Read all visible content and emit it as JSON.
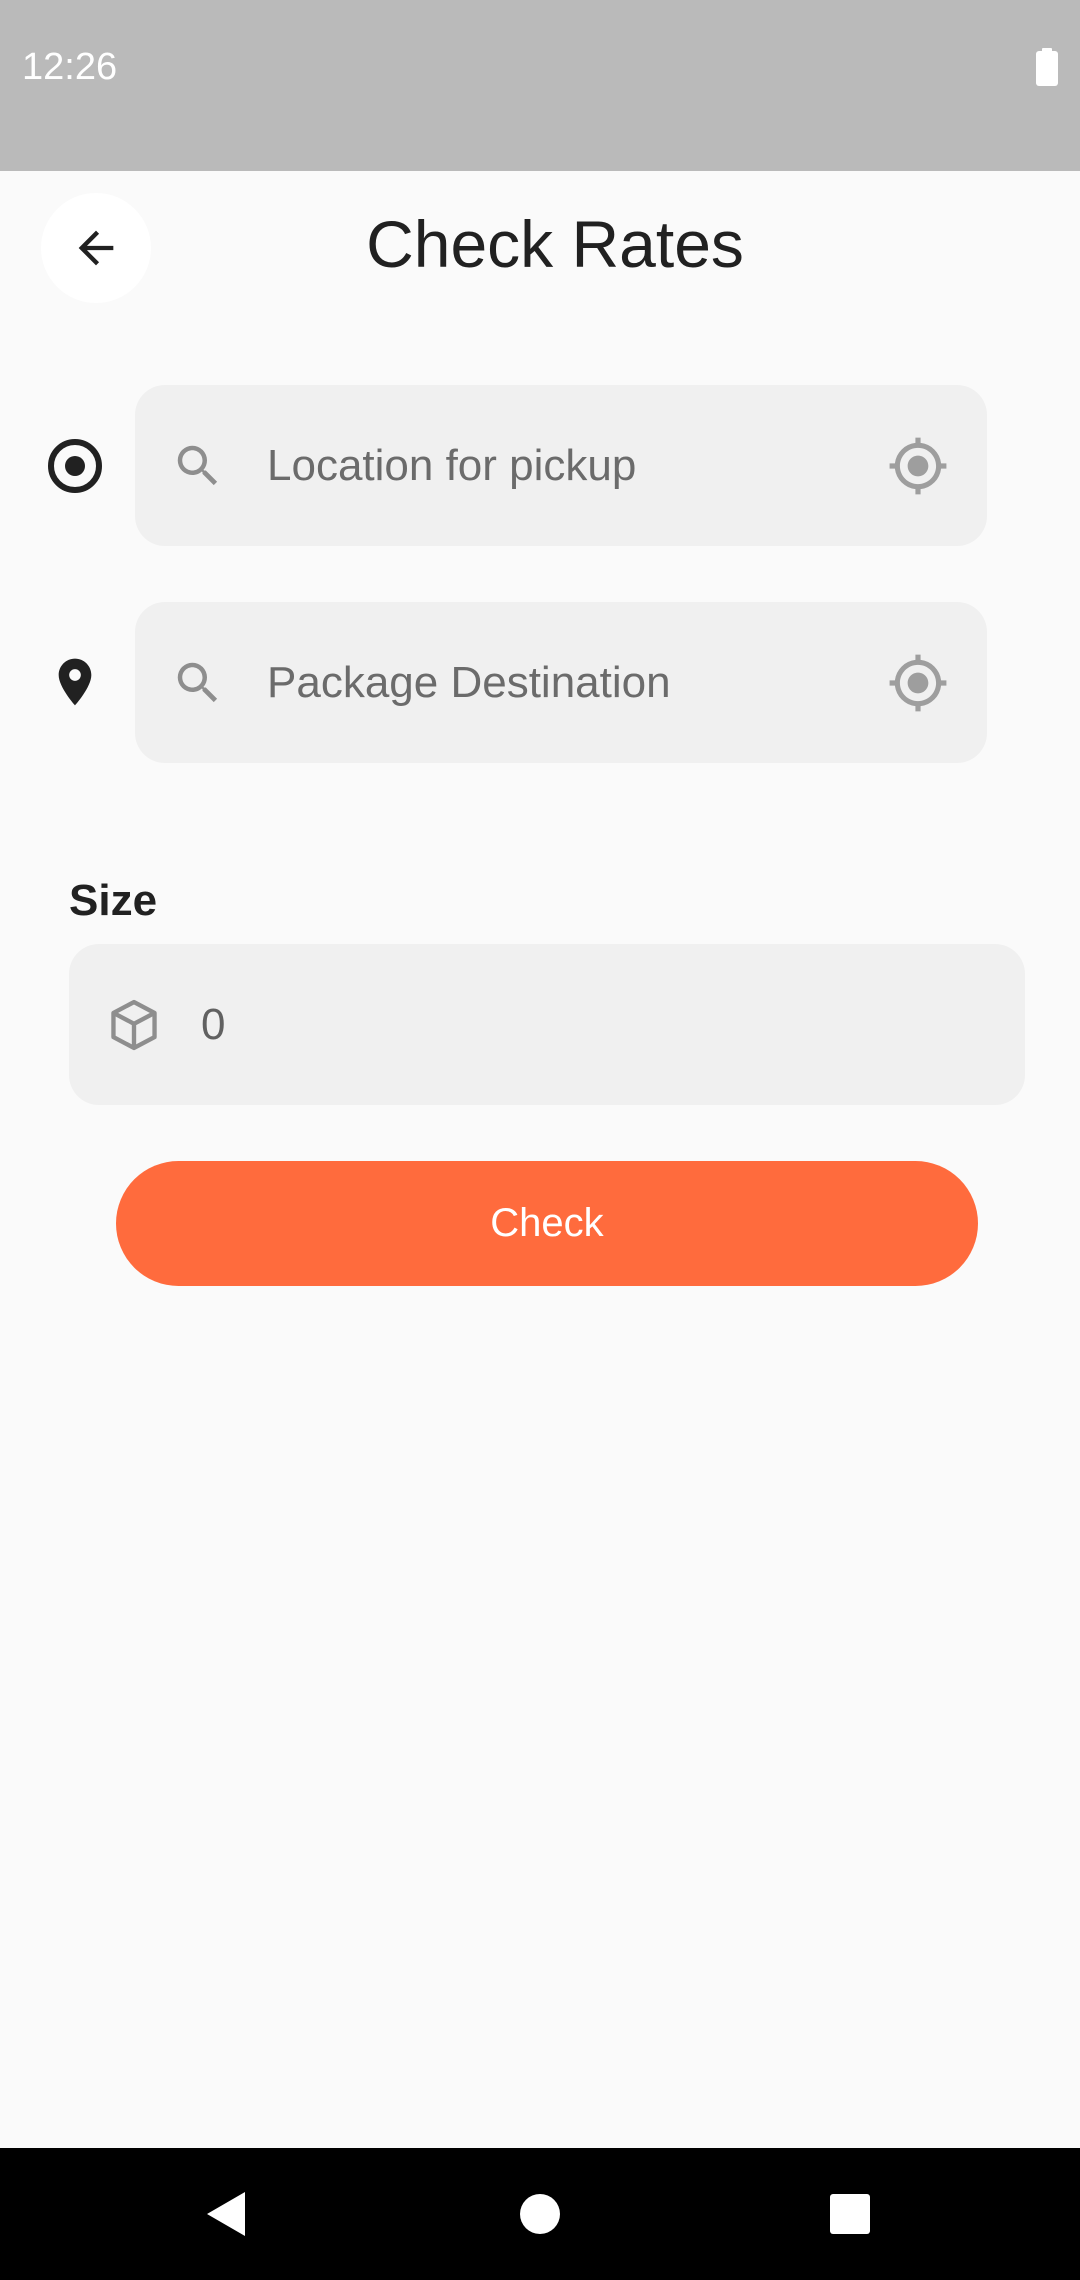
{
  "status_bar": {
    "time": "12:26",
    "battery_icon": "battery-full-icon"
  },
  "header": {
    "title": "Check Rates",
    "back_icon": "arrow-left-icon"
  },
  "pickup": {
    "marker_icon": "radio-target-icon",
    "search_icon": "search-icon",
    "placeholder": "Location for pickup",
    "value": "",
    "locate_icon": "gps-locate-icon"
  },
  "destination": {
    "marker_icon": "map-pin-icon",
    "search_icon": "search-icon",
    "placeholder": "Package Destination",
    "value": "",
    "locate_icon": "gps-locate-icon"
  },
  "size": {
    "label": "Size",
    "icon": "package-box-icon",
    "value": "0"
  },
  "actions": {
    "check_label": "Check"
  },
  "colors": {
    "accent": "#ff6b3d",
    "status_bar": "#bababa",
    "field_background": "#f0f0f0",
    "page_background": "#fafafa"
  },
  "nav_bar": {
    "back_icon": "nav-back-triangle-icon",
    "home_icon": "nav-home-circle-icon",
    "recents_icon": "nav-recents-square-icon"
  }
}
